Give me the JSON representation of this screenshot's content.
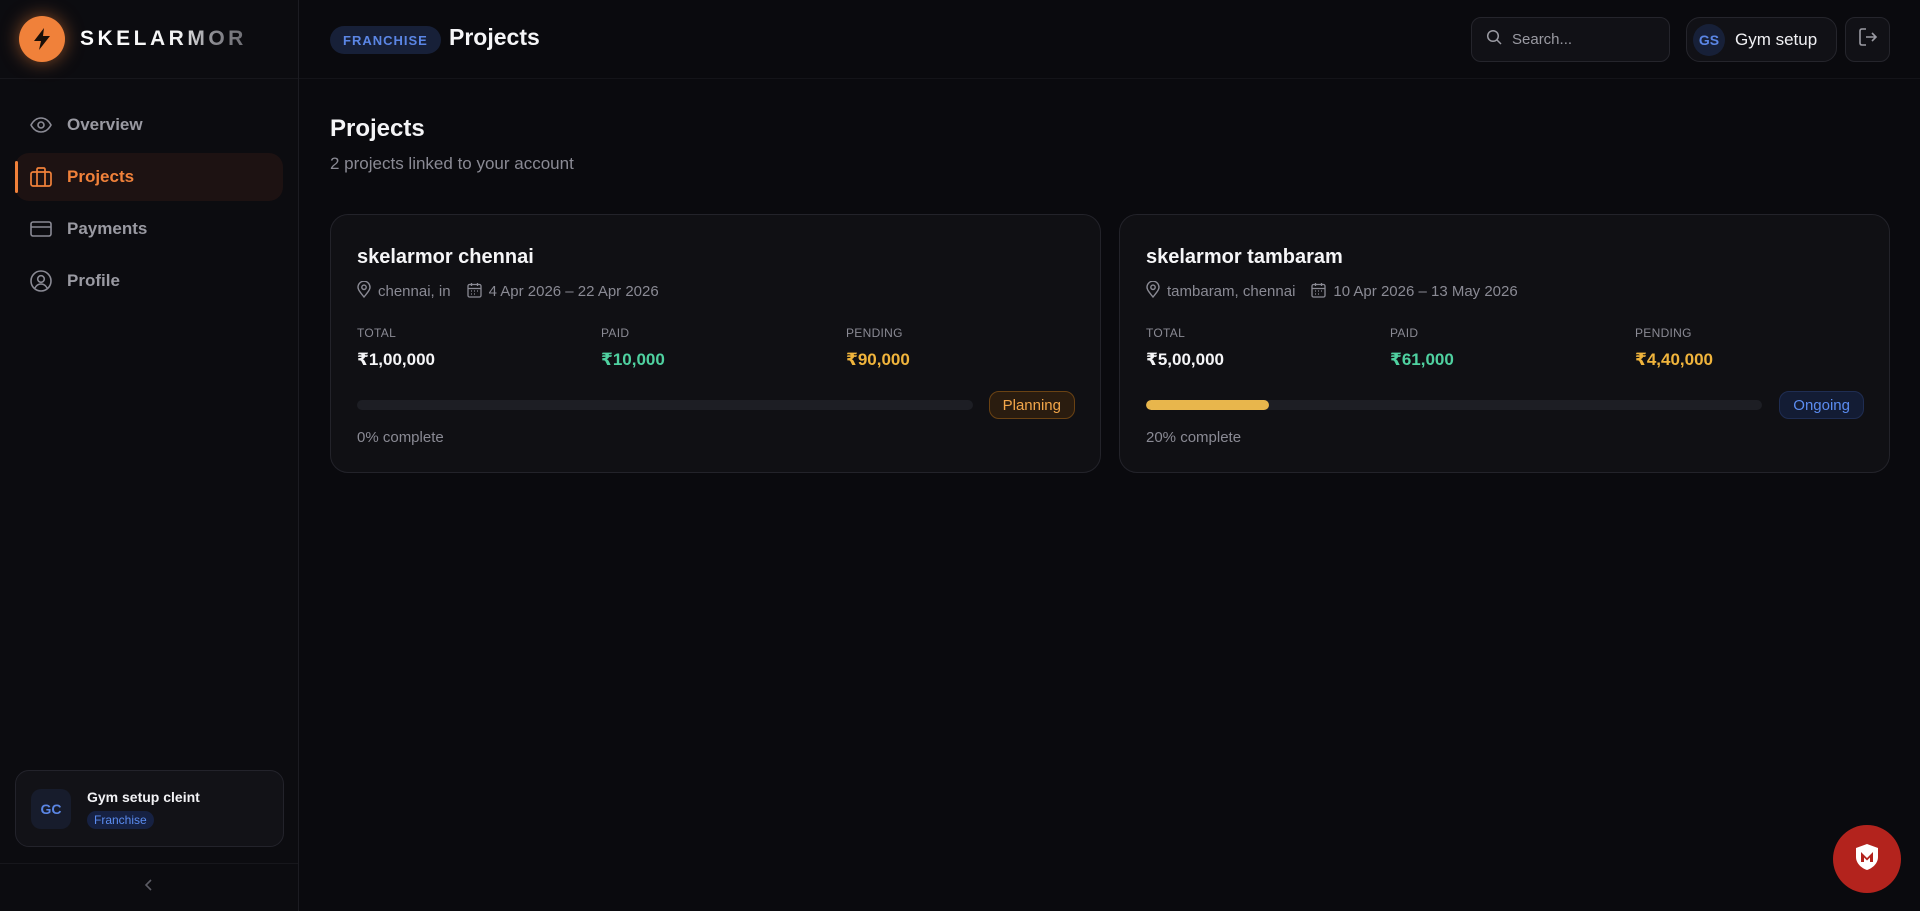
{
  "brand": {
    "name": "SKELARMOR",
    "icon": "lightning-bolt-icon",
    "accent": "#f0813a"
  },
  "sidebar": {
    "items": [
      {
        "label": "Overview",
        "icon": "eye-icon",
        "active": false
      },
      {
        "label": "Projects",
        "icon": "briefcase-icon",
        "active": true
      },
      {
        "label": "Payments",
        "icon": "credit-card-icon",
        "active": false
      },
      {
        "label": "Profile",
        "icon": "user-circle-icon",
        "active": false
      }
    ],
    "user": {
      "initials": "GC",
      "name": "Gym setup cleint",
      "role": "Franchise"
    },
    "collapse_icon": "chevron-left-icon"
  },
  "header": {
    "role_badge": "FRANCHISE",
    "title": "Projects",
    "search": {
      "placeholder": "Search...",
      "value": ""
    },
    "account": {
      "initials": "GS",
      "name": "Gym setup"
    },
    "logout_icon": "logout-icon"
  },
  "main": {
    "title": "Projects",
    "subtitle": "2 projects linked to your account",
    "projects": [
      {
        "name": "skelarmor chennai",
        "location": "chennai, in",
        "dates": "4 Apr 2026 – 22 Apr 2026",
        "total_label": "TOTAL",
        "total": "₹1,00,000",
        "paid_label": "PAID",
        "paid": "₹10,000",
        "pending_label": "PENDING",
        "pending": "₹90,000",
        "progress_percent": 0,
        "complete_text": "0% complete",
        "status": "Planning"
      },
      {
        "name": "skelarmor tambaram",
        "location": "tambaram, chennai",
        "dates": "10 Apr 2026 – 13 May 2026",
        "total_label": "TOTAL",
        "total": "₹5,00,000",
        "paid_label": "PAID",
        "paid": "₹61,000",
        "pending_label": "PENDING",
        "pending": "₹4,40,000",
        "progress_percent": 20,
        "complete_text": "20% complete",
        "status": "Ongoing"
      }
    ]
  },
  "colors": {
    "paid": "#4fd1a0",
    "pending": "#f0b43c",
    "progress": "#e8b64c"
  },
  "fab": {
    "icon": "shield-icon"
  }
}
